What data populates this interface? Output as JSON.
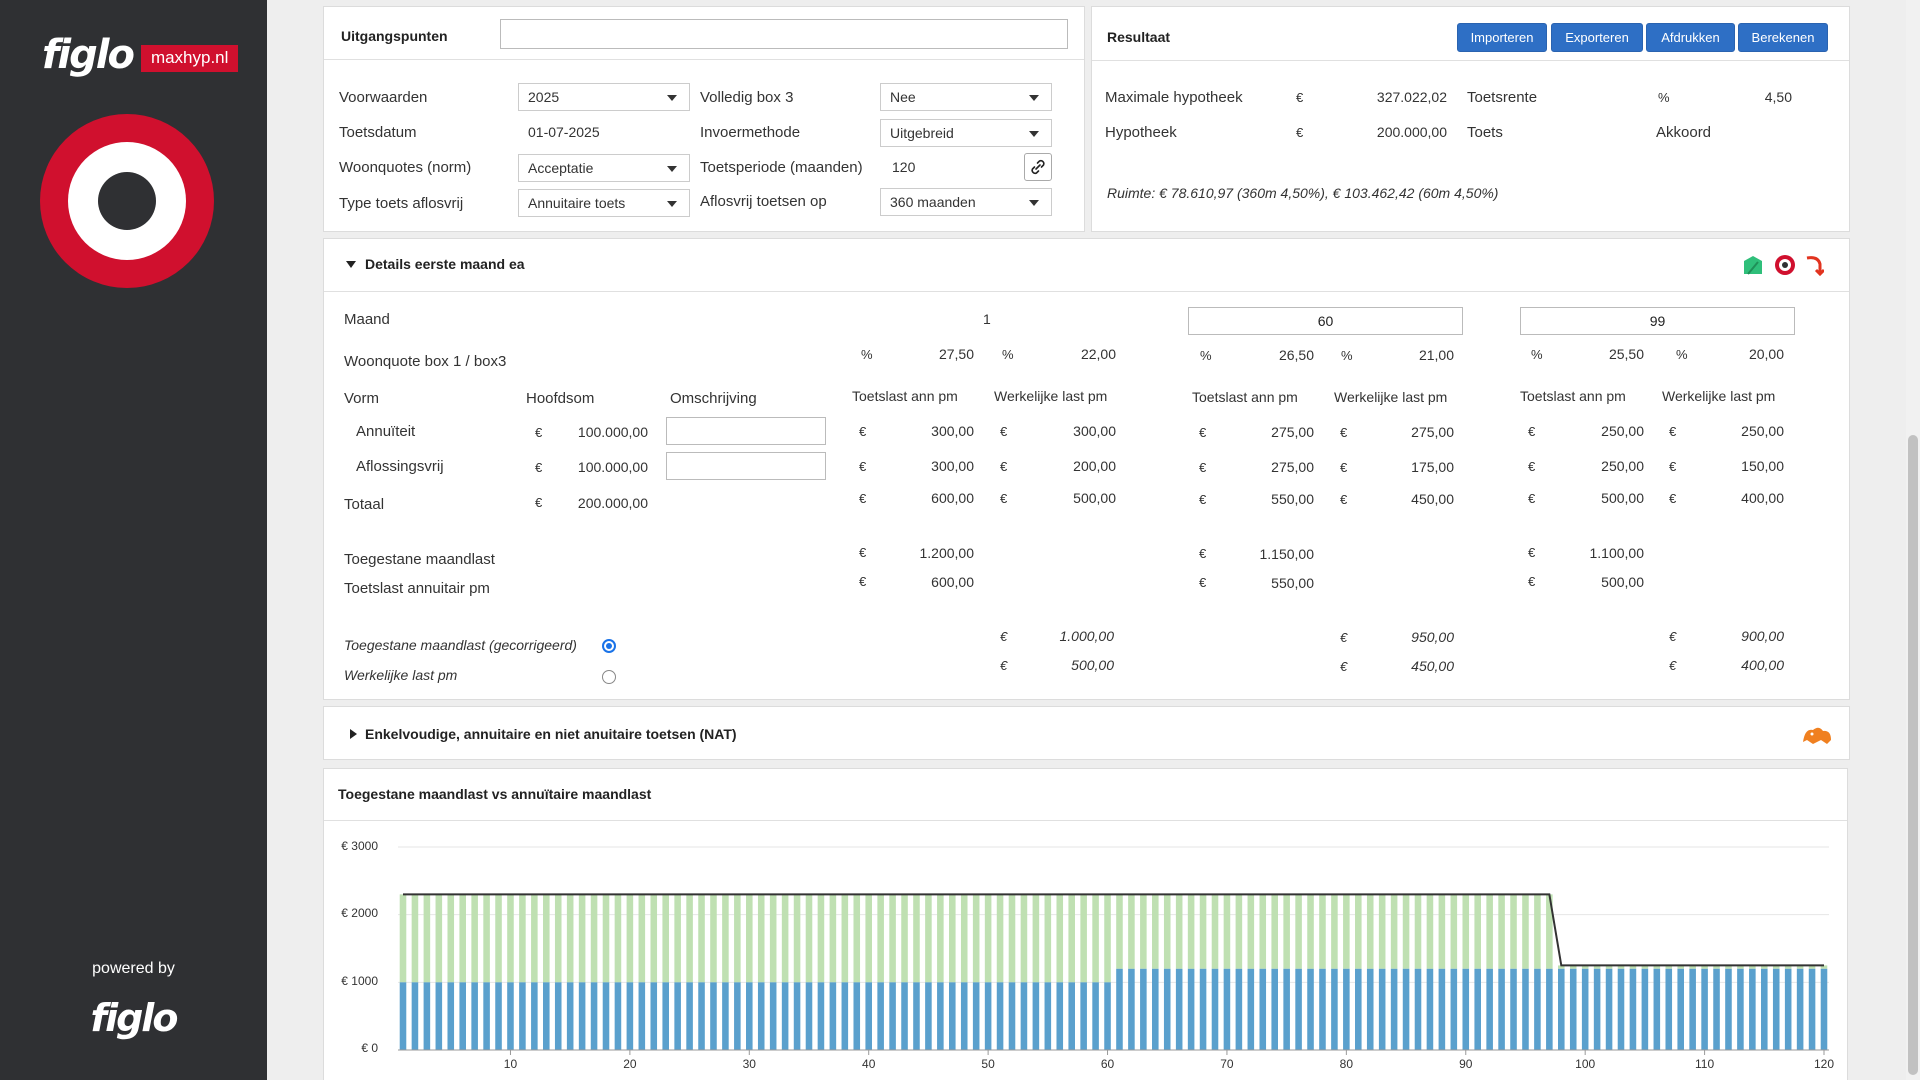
{
  "brand": {
    "name": "figlo",
    "site": "maxhyp.nl",
    "powered_by": "powered by",
    "footer_logo": "figlo"
  },
  "uitgangspunten": {
    "title": "Uitgangspunten",
    "name_value": "",
    "rows": [
      {
        "label": "Voorwaarden",
        "value": "2025",
        "type": "select"
      },
      {
        "label": "Toetsdatum",
        "value": "01-07-2025",
        "type": "text"
      },
      {
        "label": "Woonquotes (norm)",
        "value": "Acceptatie",
        "type": "select"
      },
      {
        "label": "Type toets aflosvrij",
        "value": "Annuitaire toets",
        "type": "select"
      }
    ],
    "rows_right": [
      {
        "label": "Volledig box 3",
        "value": "Nee",
        "type": "select"
      },
      {
        "label": "Invoermethode",
        "value": "Uitgebreid",
        "type": "select"
      },
      {
        "label": "Toetsperiode (maanden)",
        "value": "120",
        "type": "link"
      },
      {
        "label": "Aflosvrij toetsen op",
        "value": "360 maanden",
        "type": "select"
      }
    ],
    "link_icon": "link-icon"
  },
  "resultaat": {
    "title": "Resultaat",
    "buttons": [
      "Importeren",
      "Exporteren",
      "Afdrukken",
      "Berekenen"
    ],
    "max_hyp_label": "Maximale hypotheek",
    "max_hyp_currency": "€",
    "max_hyp_value": "327.022,02",
    "hyp_label": "Hypotheek",
    "hyp_currency": "€",
    "hyp_value": "200.000,00",
    "toetsrente_label": "Toetsrente",
    "toetsrente_unit": "%",
    "toetsrente_value": "4,50",
    "toets_label": "Toets",
    "toets_value": "Akkoord",
    "ruimte": "Ruimte: € 78.610,97 (360m 4,50%), € 103.462,42 (60m 4,50%)"
  },
  "details": {
    "title": "Details eerste maand ea",
    "icons": [
      "green-house-icon",
      "red-target-icon",
      "red-arrow-icon"
    ],
    "maand_label": "Maand",
    "woonquote_label": "Woonquote box 1 / box3",
    "vorm_label": "Vorm",
    "hoofdsom_label": "Hoofdsom",
    "omschrijving_label": "Omschrijving",
    "toetslast_label": "Toetslast ann pm",
    "werkelijk_label": "Werkelijke last pm",
    "rows": [
      {
        "vorm": "Annuïteit",
        "hoofdsom": "100.000,00",
        "omschrijving": ""
      },
      {
        "vorm": "Aflossingsvrij",
        "hoofdsom": "100.000,00",
        "omschrijving": ""
      }
    ],
    "totaal_label": "Totaal",
    "totaal_hoofdsom": "200.000,00",
    "currency": "€",
    "percent": "%",
    "toegestane_label": "Toegestane maandlast",
    "toetslast_annuitair_label": "Toetslast annuitair pm",
    "radio_gecorrigeerd": "Toegestane maandlast (gecorrigeerd)",
    "radio_werkelijk": "Werkelijke last pm",
    "radio_selected": "gecorrigeerd",
    "columns": [
      {
        "maand": "1",
        "wq1": "27,50",
        "wq3": "22,00",
        "toets": [
          "300,00",
          "300,00",
          "600,00"
        ],
        "werk": [
          "300,00",
          "200,00",
          "500,00"
        ],
        "toegestane": "1.200,00",
        "toets_ann": "600,00",
        "gecorr": "1.000,00",
        "werk_last": "500,00"
      },
      {
        "maand": "60",
        "wq1": "26,50",
        "wq3": "21,00",
        "toets": [
          "275,00",
          "275,00",
          "550,00"
        ],
        "werk": [
          "275,00",
          "175,00",
          "450,00"
        ],
        "toegestane": "1.150,00",
        "toets_ann": "550,00",
        "gecorr": "950,00",
        "werk_last": "450,00"
      },
      {
        "maand": "99",
        "wq1": "25,50",
        "wq3": "20,00",
        "toets": [
          "250,00",
          "250,00",
          "500,00"
        ],
        "werk": [
          "250,00",
          "150,00",
          "400,00"
        ],
        "toegestane": "1.100,00",
        "toets_ann": "500,00",
        "gecorr": "900,00",
        "werk_last": "400,00"
      }
    ]
  },
  "nat": {
    "title": "Enkelvoudige, annuitaire en niet anuitaire toetsen (NAT)",
    "icon": "orange-lion-icon"
  },
  "chart_data": {
    "type": "bar",
    "title": "Toegestane maandlast vs annuïtaire maandlast",
    "y_ticks": [
      "€ 3000",
      "€ 2000",
      "€ 1000",
      "€ 0"
    ],
    "ylim": [
      0,
      3000
    ],
    "x_ticks": [
      10,
      20,
      30,
      40,
      50,
      60,
      70,
      80,
      90,
      100,
      110,
      120
    ],
    "x_range": [
      1,
      120
    ],
    "series": [
      {
        "segments": [
          {
            "from": 1,
            "to": 60,
            "value": 1000
          },
          {
            "from": 61,
            "to": 97,
            "value": 1200
          },
          {
            "from": 98,
            "to": 120,
            "value": 1200
          }
        ],
        "color": "#5aa0cd"
      },
      {
        "segments": [
          {
            "from": 1,
            "to": 97,
            "value": 2300
          },
          {
            "from": 98,
            "to": 120,
            "value": 1250
          }
        ],
        "color": "#bfe0b2"
      },
      {
        "segments": [
          {
            "from": 1,
            "to": 97,
            "value": 2300
          },
          {
            "from": 98,
            "to": 120,
            "value": 1250
          }
        ],
        "color": "#333333"
      }
    ],
    "grid": true
  }
}
